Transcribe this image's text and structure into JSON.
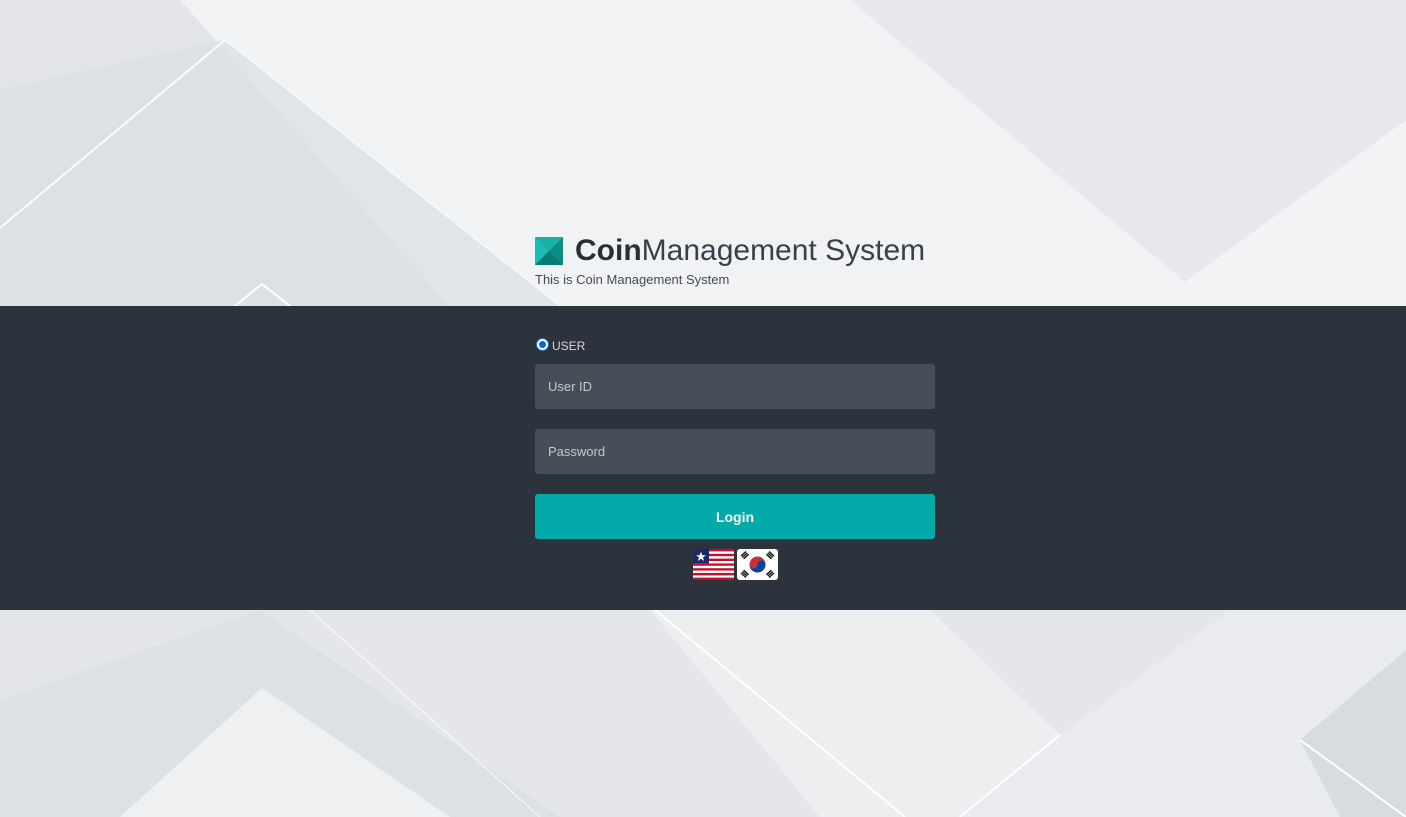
{
  "brand": {
    "title_bold": "Coin",
    "title_rest": "Management System",
    "subtitle": "This is Coin Management System",
    "logo_icon": "teal-square-logo-icon"
  },
  "login": {
    "role_label": "USER",
    "role_selected": true,
    "user_id_placeholder": "User ID",
    "user_id_value": "",
    "password_placeholder": "Password",
    "password_value": "",
    "login_label": "Login"
  },
  "languages": [
    {
      "icon": "us-flag-icon",
      "code": "en"
    },
    {
      "icon": "korea-flag-icon",
      "code": "ko"
    }
  ],
  "colors": {
    "band": "#2c333c",
    "input_bg": "#464e57",
    "accent": "#03aaaa",
    "page_bg": "#eceef0"
  }
}
